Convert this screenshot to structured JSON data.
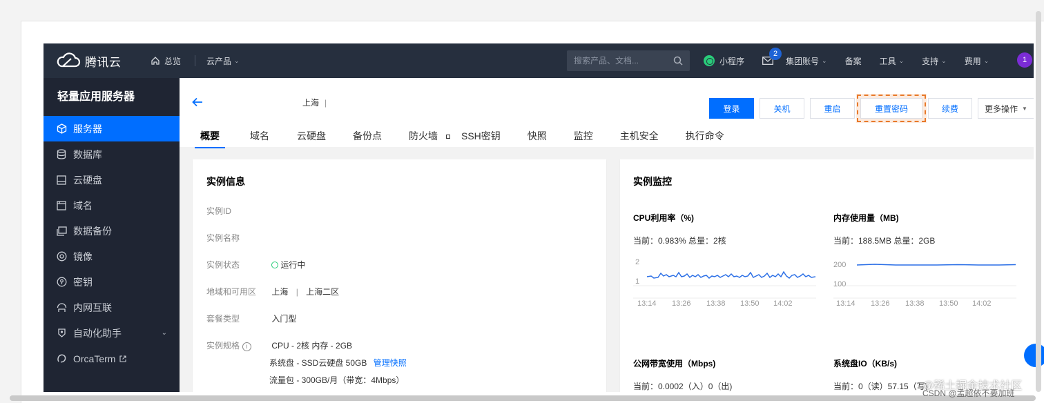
{
  "brand": {
    "name": "腾讯云"
  },
  "topnav": {
    "home": "总览",
    "products": "云产品",
    "search_placeholder": "搜索产品、文档...",
    "miniprogram": "小程序",
    "mail_badge": "2",
    "group_account": "集团账号",
    "record": "备案",
    "tools": "工具",
    "support": "支持",
    "billing": "费用",
    "avatar": "1"
  },
  "sidebar": {
    "title": "轻量应用服务器",
    "items": [
      {
        "label": "服务器",
        "icon": "cube-icon",
        "active": true
      },
      {
        "label": "数据库",
        "icon": "database-icon"
      },
      {
        "label": "云硬盘",
        "icon": "disk-icon"
      },
      {
        "label": "域名",
        "icon": "domain-icon"
      },
      {
        "label": "数据备份",
        "icon": "backup-icon"
      },
      {
        "label": "镜像",
        "icon": "image-icon"
      },
      {
        "label": "密钥",
        "icon": "key-icon"
      },
      {
        "label": "内网互联",
        "icon": "network-icon"
      },
      {
        "label": "自动化助手",
        "icon": "automation-icon"
      },
      {
        "label": "OrcaTerm",
        "icon": "terminal-icon"
      }
    ]
  },
  "header": {
    "region": "上海",
    "sep": "|"
  },
  "actions": {
    "login": "登录",
    "shutdown": "关机",
    "restart": "重启",
    "reset_password": "重置密码",
    "renew": "续费",
    "more": "更多操作"
  },
  "tabs": [
    "概要",
    "域名",
    "云硬盘",
    "备份点",
    "防火墙",
    "SSH密钥",
    "快照",
    "监控",
    "主机安全",
    "执行命令"
  ],
  "instance_info": {
    "title": "实例信息",
    "rows": {
      "id_label": "实例ID",
      "name_label": "实例名称",
      "status_label": "实例状态",
      "status_value": "运行中",
      "region_label": "地域和可用区",
      "region_value": "上海",
      "zone_value": "上海二区",
      "region_sep": "|",
      "plan_label": "套餐类型",
      "plan_value": "入门型",
      "spec_label": "实例规格",
      "spec_cpu": "CPU - 2核 内存 - 2GB",
      "spec_disk": "系统盘 - SSD云硬盘 50GB",
      "spec_disk_link": "管理快照",
      "spec_traffic": "流量包 - 300GB/月（带宽：4Mbps）"
    }
  },
  "monitor": {
    "title": "实例监控",
    "cpu": {
      "title": "CPU利用率（%)",
      "current": "当前：0.983% 总量：2核",
      "y_ticks": [
        "2",
        "1"
      ],
      "x_ticks": [
        "13:14",
        "13:26",
        "13:38",
        "13:50",
        "14:02"
      ]
    },
    "mem": {
      "title": "内存使用量（MB)",
      "current": "当前：188.5MB 总量：2GB",
      "y_ticks": [
        "200",
        "100"
      ],
      "x_ticks": [
        "13:14",
        "13:26",
        "13:38",
        "13:50",
        "14:02"
      ]
    },
    "net": {
      "title": "公网带宽使用（Mbps)",
      "current": "当前：0.0002（入）0（出)"
    },
    "disk": {
      "title": "系统盘IO（KB/s)",
      "current": "当前：0（读）57.15（写)"
    }
  },
  "watermark": {
    "line1": "@稀土掘金技术社区",
    "line2": "CSDN @孟超依不要加班"
  }
}
